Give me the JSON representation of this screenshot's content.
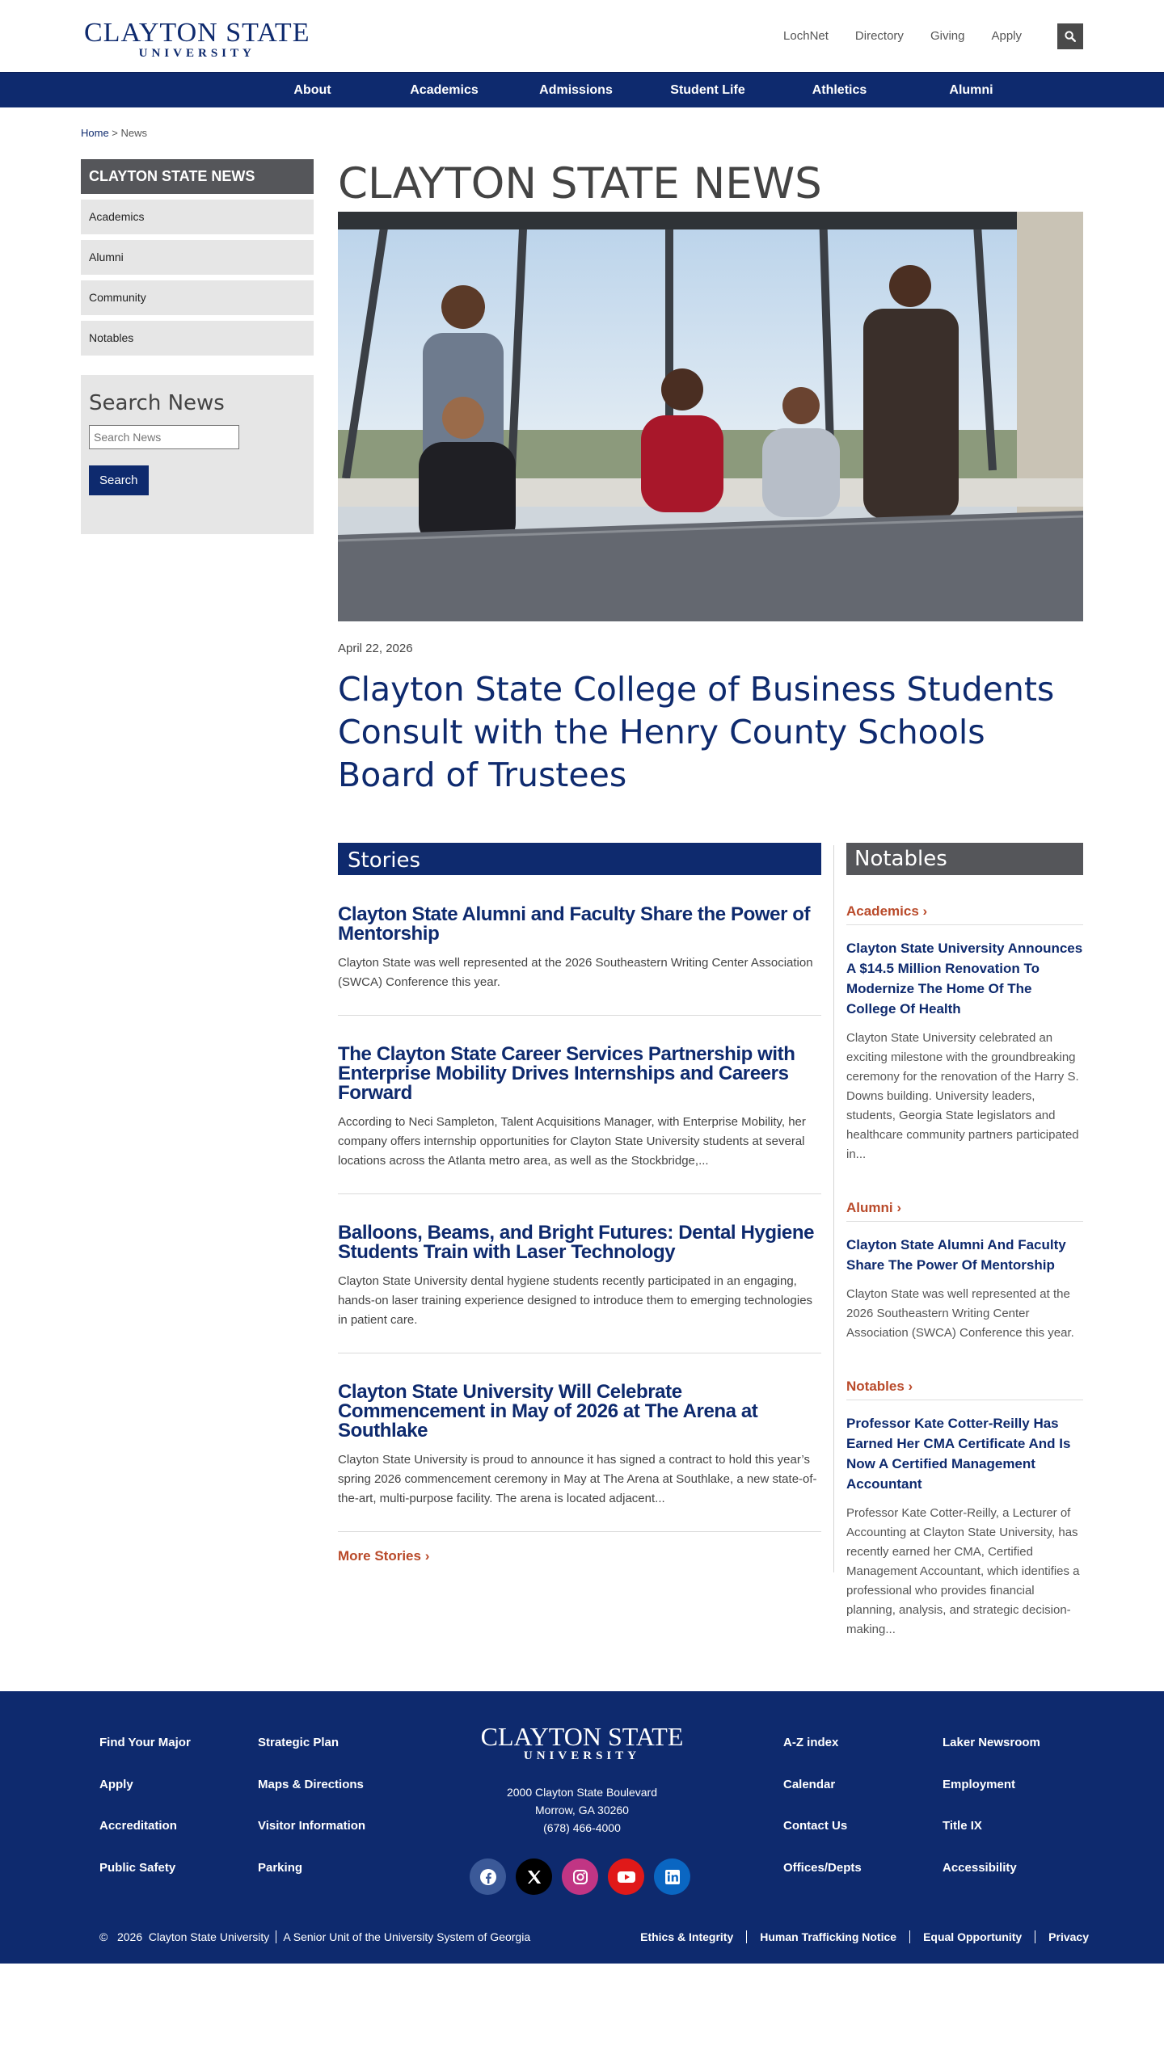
{
  "logo": {
    "line1": "CLAYTON STATE",
    "line2": "UNIVERSITY"
  },
  "utility": [
    "LochNet",
    "Directory",
    "Giving",
    "Apply"
  ],
  "nav": [
    "About",
    "Academics",
    "Admissions",
    "Student Life",
    "Athletics",
    "Alumni"
  ],
  "breadcrumb": {
    "home": "Home",
    "sep": " > ",
    "current": "News"
  },
  "sidebar": {
    "heading": "CLAYTON STATE NEWS",
    "items": [
      "Academics",
      "Alumni",
      "Community",
      "Notables"
    ],
    "search_title": "Search News",
    "search_placeholder": "Search News",
    "search_button": "Search"
  },
  "main": {
    "title": "CLAYTON STATE NEWS",
    "date": "April 22, 2026",
    "headline": "Clayton State College of Business Students Consult with the Henry County Schools Board of Trustees"
  },
  "stories": {
    "heading": "Stories",
    "items": [
      {
        "title": "Clayton State Alumni and Faculty Share the Power of Mentorship",
        "summary": "Clayton State was well represented at the 2026 Southeastern Writing Center Association (SWCA) Conference this year."
      },
      {
        "title": "The Clayton State Career Services Partnership with Enterprise Mobility Drives Internships and Careers Forward",
        "summary": "According to Neci Sampleton, Talent Acquisitions Manager, with Enterprise Mobility, her company offers internship opportunities for Clayton State University students at several locations across the Atlanta metro area, as well as the Stockbridge,..."
      },
      {
        "title": "Balloons, Beams, and Bright Futures: Dental Hygiene Students Train with Laser Technology",
        "summary": "Clayton State University dental hygiene students recently participated in an engaging, hands-on laser training experience designed to introduce them to emerging technologies in patient care."
      },
      {
        "title": "Clayton State University Will Celebrate Commencement in May of 2026 at The Arena at Southlake",
        "summary": "Clayton State University is proud to announce it has signed a contract to hold this year’s spring 2026 commencement ceremony in May at The Arena at Southlake, a new state-of-the-art, multi-purpose facility. The arena is located adjacent..."
      }
    ],
    "more": "More Stories"
  },
  "notables": {
    "heading": "Notables",
    "items": [
      {
        "category": "Academics",
        "title": "Clayton State University Announces A $14.5 Million Renovation To Modernize The Home Of The College Of Health",
        "summary": "Clayton State University celebrated an exciting milestone with the groundbreaking ceremony for the renovation of the Harry S. Downs building. University leaders, students, Georgia State legislators and healthcare community partners participated in..."
      },
      {
        "category": "Alumni",
        "title": "Clayton State Alumni And Faculty Share The Power Of Mentorship",
        "summary": "Clayton State was well represented at the 2026 Southeastern Writing Center Association (SWCA) Conference this year."
      },
      {
        "category": "Notables",
        "title": "Professor Kate Cotter-Reilly Has Earned Her CMA Certificate And Is Now A Certified Management Accountant",
        "summary": "Professor Kate Cotter-Reilly, a Lecturer of Accounting at Clayton State University, has recently earned her CMA, Certified Management Accountant, which identifies a professional who provides financial planning, analysis, and strategic decision-making..."
      }
    ]
  },
  "footer": {
    "col1": [
      "Find Your Major",
      "Apply",
      "Accreditation",
      "Public Safety"
    ],
    "col2": [
      "Strategic Plan",
      "Maps & Directions",
      "Visitor Information",
      "Parking"
    ],
    "col3": [
      "A-Z index",
      "Calendar",
      "Contact Us",
      "Offices/Depts"
    ],
    "col4": [
      "Laker Newsroom",
      "Employment",
      "Title IX",
      "Accessibility"
    ],
    "address": [
      "2000 Clayton State Boulevard",
      "Morrow, GA 30260",
      "(678) 466-4000"
    ],
    "socials": [
      {
        "name": "facebook-icon",
        "color": "#3b5998"
      },
      {
        "name": "x-icon",
        "color": "#000000"
      },
      {
        "name": "instagram-icon",
        "color": "#c13584"
      },
      {
        "name": "youtube-icon",
        "color": "#e01919"
      },
      {
        "name": "linkedin-icon",
        "color": "#0a66c2"
      }
    ],
    "copyright": "©   2026  Clayton State University",
    "system": "A Senior Unit of the University System of Georgia",
    "links": [
      "Ethics & Integrity",
      "Human Trafficking Notice",
      "Equal Opportunity",
      "Privacy"
    ]
  },
  "colors": {
    "navy": "#0e2a6e",
    "accent": "#b94a2a",
    "gray": "#55565a"
  }
}
